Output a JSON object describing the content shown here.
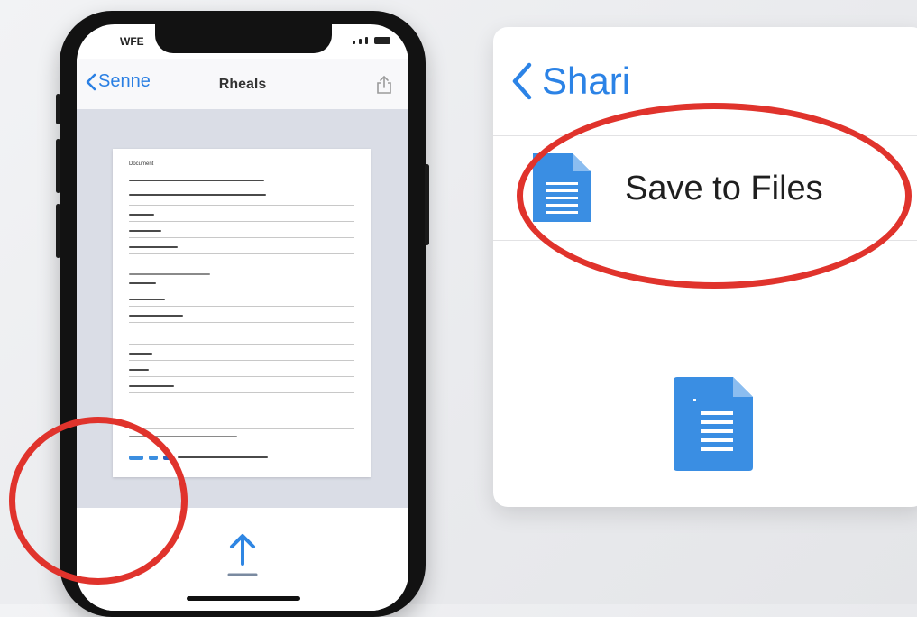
{
  "phone": {
    "status": {
      "time": "WFE"
    },
    "nav": {
      "back_label": "Senne",
      "title": "Rheals"
    },
    "document": {
      "heading": "Document",
      "line_count": 22
    }
  },
  "card": {
    "back_label": "Shari",
    "action_label": "Save to Files"
  },
  "colors": {
    "accent": "#2c83e6",
    "annotation": "#e0332c",
    "file_icon": "#3a8ee3"
  },
  "icons": [
    "chevron-left-icon",
    "share-icon",
    "upload-arrow-icon",
    "document-file-icon"
  ]
}
